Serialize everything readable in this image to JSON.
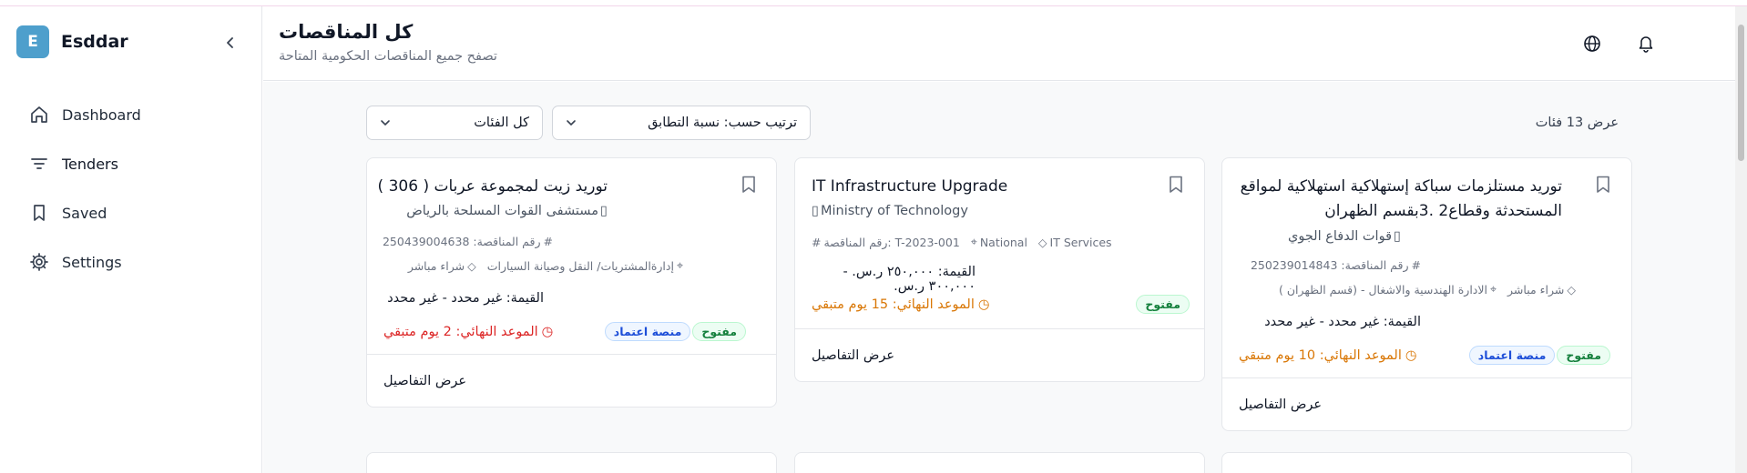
{
  "brand": {
    "logo_letter": "E",
    "name": "Esddar",
    "color": "#4e9fcc"
  },
  "sidebar": {
    "items": [
      {
        "label": "Dashboard",
        "icon": "home-icon"
      },
      {
        "label": "Tenders",
        "icon": "filter-lines-icon",
        "active": true
      },
      {
        "label": "Saved",
        "icon": "bookmark-icon"
      },
      {
        "label": "Settings",
        "icon": "gear-icon"
      }
    ]
  },
  "header": {
    "title": "كل المناقصات",
    "subtitle": "تصفح جميع المناقصات الحكومية المتاحة",
    "icons": [
      "globe-icon",
      "bell-icon"
    ]
  },
  "filters": {
    "sort_label": "ترتيب حسب: نسبة التطابق",
    "category_label": "كل الفئات",
    "results_count": "عرض 13 فئات"
  },
  "cards": [
    {
      "title": "توريد مستلزمات سباكة إستهلاكية استهلاكية لمواقع المستحدثة وقطاع2 .3بقسم الظهران",
      "org": "قوات الدفاع الجوي",
      "tender_no": "رقم المناقصة: 250239014843",
      "type": "شراء مباشر",
      "location": "الادارة الهندسية والاشغال - (قسم الظهران )",
      "value": "القيمة: غير محدد - غير محدد",
      "deadline": "الموعد النهائي: 10 يوم متبقي",
      "deadline_tone": "orange",
      "badges": [
        "مفتوح",
        "منصة اعتماد"
      ],
      "details": "عرض التفاصيل"
    },
    {
      "title": "IT Infrastructure Upgrade",
      "org": "Ministry of Technology",
      "tender_no": "رقم المناقصة: T-2023-001",
      "location": "National",
      "category": "IT Services",
      "value": "القيمة: ٢٥٠,٠٠٠ ر.س. - ٣٠٠,٠٠٠ ر.س.",
      "deadline": "الموعد النهائي: 15 يوم متبقي",
      "deadline_tone": "orange",
      "badges": [
        "مفتوح"
      ],
      "details": "عرض التفاصيل"
    },
    {
      "title": "توريد زيت لمجموعة عربات ( 306 )",
      "org": "مستشفى القوات المسلحة بالرياض",
      "tender_no": "رقم المناقصة: 250439004638",
      "type": "شراء مباشر",
      "location": "إدارةالمشتريات/ النقل وصيانة السيارات",
      "value": "القيمة: غير محدد - غير محدد",
      "deadline": "الموعد النهائي: 2 يوم متبقي",
      "deadline_tone": "red",
      "badges": [
        "مفتوح",
        "منصة اعتماد"
      ],
      "details": "عرض التفاصيل"
    }
  ]
}
